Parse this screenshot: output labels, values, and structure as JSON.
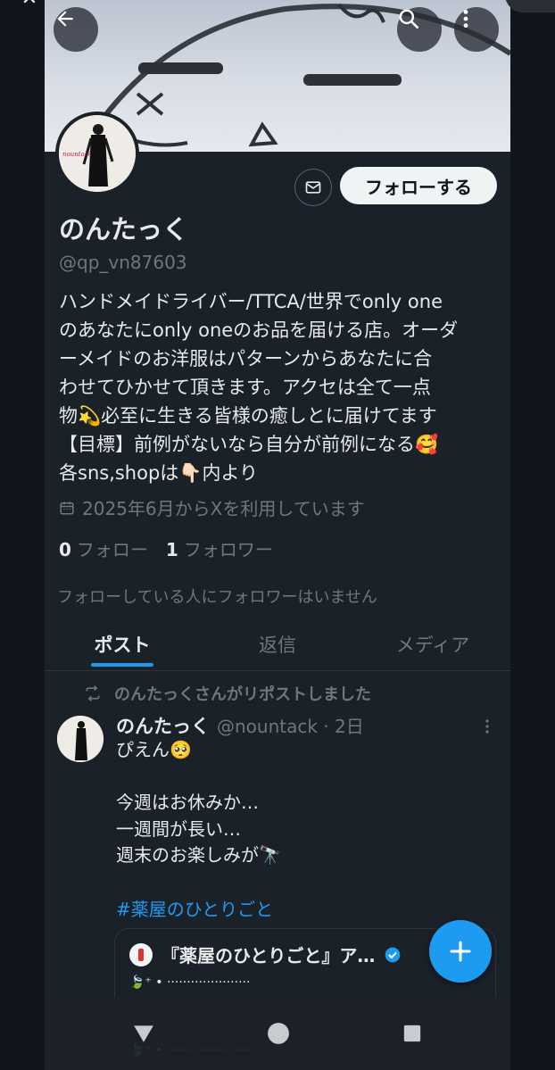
{
  "profile": {
    "display_name": "のんたっく",
    "handle": "@qp_vn87603",
    "bio": "ハンドメイドライバー/TTCA/世界でonly one\nのあなたにonly oneのお品を届ける店。オーダ\nーメイドのお洋服はパターンからあなたに合\nわせてひかせて頂きます。アクセは全て一点\n物💫必至に生きる皆様の癒しとに届けてます\n【目標】前例がないなら自分が前例になる🥰\n各sns,shopは👇🏻内より",
    "joined": "2025年6月からXを利用しています",
    "following_count": "0",
    "following_label": "フォロー",
    "followers_count": "1",
    "followers_label": "フォロワー",
    "mutual_note": "フォローしている人にフォロワーはいません",
    "avatar_caption": "nountack"
  },
  "actions": {
    "follow_label": "フォローする"
  },
  "tabs": [
    "ポスト",
    "返信",
    "メディア"
  ],
  "post": {
    "repost_note": "のんたっくさんがリポストしました",
    "author_name": "のんたっく",
    "author_meta": "@nountack · 2日",
    "text_lines": [
      "ぴえん🥺",
      "",
      "今週はお休みか…",
      "一週間が長い…",
      "週末のお楽しみが🔭"
    ],
    "hashtag": "#薬屋のひとりごと",
    "quote_title": "『薬屋のひとりごと』ア…",
    "quote_line1": "🍃⁺ • ·····················",
    "quote_line2": "🍃⁺ • ·····················"
  },
  "colors": {
    "background": "#1b2129",
    "accent": "#1d9bf0",
    "muted": "#71767b",
    "text": "#e7e9ea"
  },
  "icons": {
    "back": "arrow-left-icon",
    "search": "search-icon",
    "more": "more-vertical-icon",
    "mail": "envelope-icon",
    "calendar": "calendar-icon",
    "repost": "repost-icon",
    "compose": "plus-icon",
    "nav_back": "triangle-back-icon",
    "nav_home": "circle-home-icon",
    "nav_recents": "square-recents-icon"
  }
}
